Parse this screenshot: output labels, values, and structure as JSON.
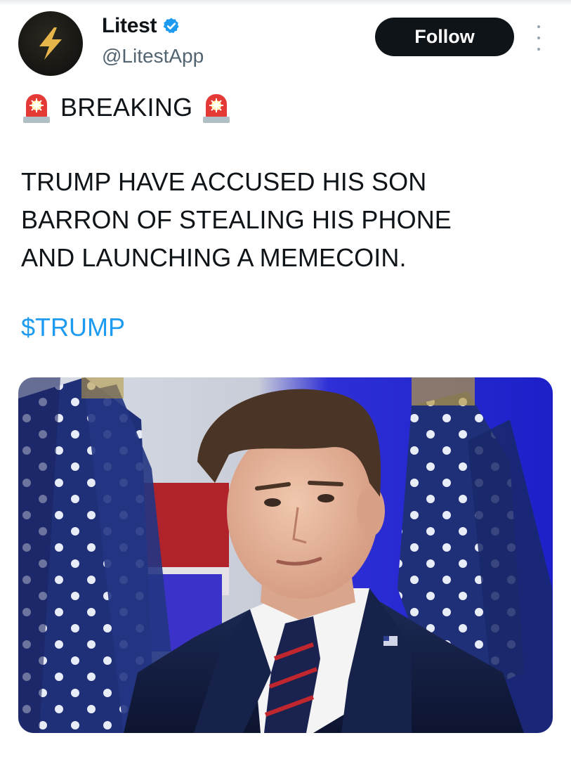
{
  "author": {
    "display_name": "Litest",
    "handle": "@LitestApp",
    "avatar_icon": "lightning-bolt-icon",
    "verified_icon": "verified-badge-icon"
  },
  "actions": {
    "follow_label": "Follow",
    "more_icon": "more-options-icon"
  },
  "tweet": {
    "breaking_label": "BREAKING",
    "siren_icon": "police-siren-emoji",
    "text": "TRUMP HAVE ACCUSED HIS SON\nBARRON OF STEALING HIS PHONE\nAND LAUNCHING A MEMECOIN.",
    "cashtag": "$TRUMP"
  },
  "colors": {
    "link": "#1d9bf0",
    "text": "#0f1419",
    "secondary": "#536471",
    "button_bg": "#0f1419"
  }
}
